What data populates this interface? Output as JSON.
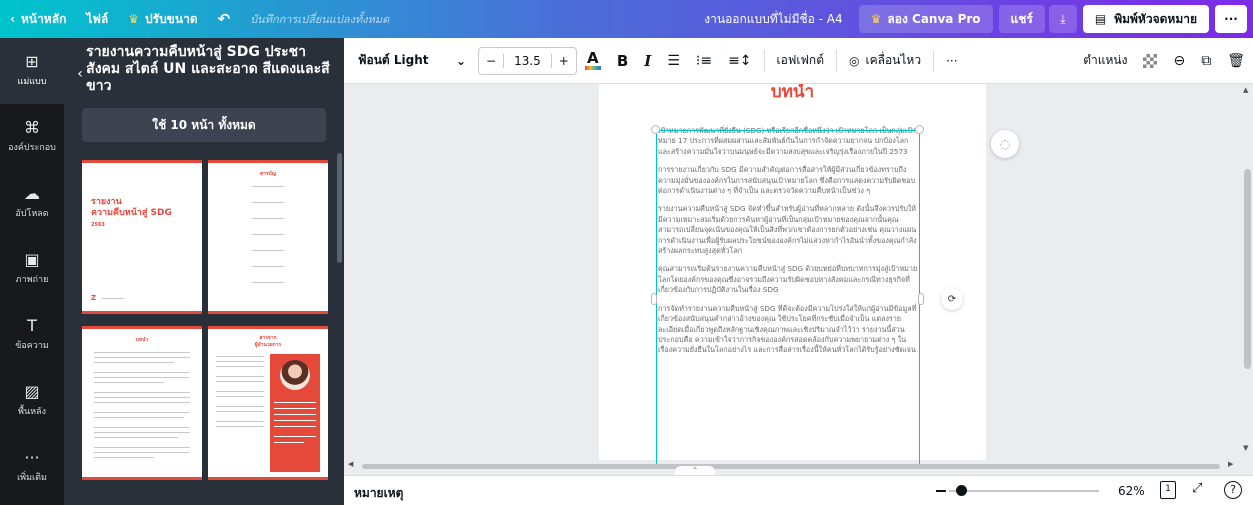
{
  "topbar": {
    "home": "หน้าหลัก",
    "file": "ไฟล์",
    "resize": "ปรับขนาด",
    "undo_icon": "undo-icon",
    "saved_status": "บันทึกการเปลี่ยนแปลงทั้งหมด",
    "doc_name": "งานออกแบบที่ไม่มีชื่อ - A4",
    "try_pro": "ลอง Canva Pro",
    "share": "แชร์",
    "print": "พิมพ์หัวจดหมาย",
    "more": "···"
  },
  "rail": [
    {
      "label": "แม่แบบ",
      "icon": "template-icon",
      "glyph": "⊞"
    },
    {
      "label": "องค์ประกอบ",
      "icon": "elements-icon",
      "glyph": "⌘"
    },
    {
      "label": "อัปโหลด",
      "icon": "upload-icon",
      "glyph": "☁"
    },
    {
      "label": "ภาพถ่าย",
      "icon": "photo-icon",
      "glyph": "▣"
    },
    {
      "label": "ข้อความ",
      "icon": "text-icon",
      "glyph": "T"
    },
    {
      "label": "พื้นหลัง",
      "icon": "background-icon",
      "glyph": "▨"
    },
    {
      "label": "เพิ่มเติม",
      "icon": "more-icon",
      "glyph": "···"
    }
  ],
  "panel": {
    "title": "รายงานความคืบหน้าสู่ SDG ประชาสังคม สไตล์ UN และสะอาด สีแดงและสีขาว",
    "use_all": "ใช้ 10 หน้า ทั้งหมด",
    "thumb1": {
      "title_line1": "รายงาน",
      "title_line2": "ความคืบหน้าสู่ SDG",
      "year": "2563"
    },
    "thumb2": {
      "title": "สารบัญ"
    },
    "thumb3": {
      "title": "บทนำ"
    },
    "thumb4": {
      "title": "สารจาก",
      "subtitle": "ผู้อำนวยการ"
    }
  },
  "toolbar": {
    "font": "ฟ้อนต์ Light",
    "minus": "−",
    "size": "13.5",
    "plus": "+",
    "color": "A",
    "bold": "B",
    "italic": "I",
    "effects": "เอฟเฟกต์",
    "animate": "เคลื่อนไหว",
    "more": "···",
    "position": "ตำแหน่ง"
  },
  "page": {
    "heading": "บทนำ",
    "paragraphs": [
      "เป้าหมายการพัฒนาที่ยั่งยืน (SDG) หรือเรียกอีกชื่อหนึ่งว่า เป้าหมายโลก เป็นกลุ่มเป้าหมาย 17 ประการที่ผสมผสานและสัมพันธ์กันในการกำจัดความยากจน ปกป้องโลก และสร้างความมั่นใจว่าบนมนุษย์จะมีความสงบสุขและเจริญรุ่งเรืองภายในปี 2573",
      "การรายงานเกี่ยวกับ SDG มีความสำคัญต่อการสื่อสารให้ผู้มีส่วนเกี่ยวข้องทราบถึงความมุ่งมั่นขององค์กรในการสนับสนุนเป้าหมายโลก ซึ่งคือการแสดงความรับผิดชอบต่อการดำเนินงานต่าง ๆ ที่จำเป็น และตรวจวัดความคืบหน้าเป็นช่วง ๆ",
      "รายงานความคืบหน้าสู่ SDG จัดทำขึ้นสำหรับผู้อ่านที่หลากหลาย ดังนั้นจึงควรปรับให้มีความเหมาะสมเริ่มด้วยการค้นหาผู้อ่านที่เป็นกลุ่มเป้าหมายของคุณจากนั้นคุณสามารถเปลี่ยนจุดเน้นของคุณให้เป็นสิ่งที่พวกเขาต้องการยกตัวอย่างเช่น คุณวางแผนการดำเนินงานเพื่อผู้รับผลประโยชน์ขององค์กรไม่แสวงหากำไรอันนำทั้งของคุณกำลังสร้างผลกระทบสูงสุดทั่วโลก",
      "คุณสามารถเริ่มต้นรายงานความคืบหน้าสู่ SDG ด้วยบทย่อที่บทบาทการมุ่งสู่เป้าหมายโลกโดยองค์กรของคุณซึ่งอาจรวมถึงความรับผิดชอบทางสังคมและกรณีทางธุรกิจที่เกี่ยวข้องกับการปฏิบัติงานในเรื่อง SDG",
      "การจัดทำรายงานความคืบหน้าสู่ SDG ที่ดีจะต้องมีความโปร่งใสให้แก่ผู้อ่านมีข้อมูลที่เกี่ยวข้องสนับสนุนคำกล่าวอ้างของคุณ ใช้ประโยคที่กระชับเมื่อจำเป็น แต่ลงรายละเอียดเมื่อเกี่ยวพูดถึงหลักฐานเชิงคุณภาพและเชิงปริมาณจำไว้ว่า รายงานนี้ส่วนประกอบคือ ความเข้าใจว่าการกิจขององค์กรสอดคล้องกับความพยายามต่าง ๆ ในเรื่องความยั่งยืนในโลกอย่างไร และการสื่อสารเรื่องนี้ให้คนทั่วโลกได้รับรู้อย่างชัดเจน"
    ]
  },
  "bottombar": {
    "notes": "หมายเหตุ",
    "zoom": "62%",
    "page_num": "1",
    "help": "?"
  }
}
